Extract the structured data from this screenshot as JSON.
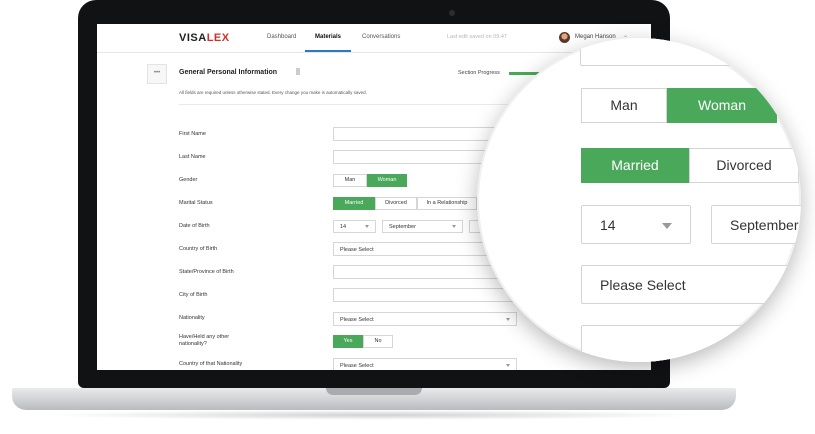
{
  "app": {
    "logo_prefix": "VISA",
    "logo_accent": "LEX"
  },
  "nav": {
    "dashboard": "Dashboard",
    "materials": "Materials",
    "conversations": "Conversations"
  },
  "status": {
    "last_saved": "Last edit saved on 09:47"
  },
  "user": {
    "name": "Megan Hanson"
  },
  "section": {
    "title": "General Personal Information",
    "progress_label": "Section Progress",
    "note": "All fields are required unless otherwise stated. Every change you make is automatically saved."
  },
  "form": {
    "first_name_label": "First Name",
    "last_name_label": "Last Name",
    "gender_label": "Gender",
    "gender_options": [
      "Man",
      "Woman"
    ],
    "marital_label": "Marital Status",
    "marital_options": [
      "Married",
      "Divorced",
      "In a Relationship"
    ],
    "dob_label": "Date of Birth",
    "dob_day": "14",
    "dob_month": "September",
    "country_birth_label": "Country of Birth",
    "country_birth_value": "Please Select",
    "state_birth_label": "State/Province of Birth",
    "city_birth_label": "City of Birth",
    "nationality_label": "Nationality",
    "nationality_value": "Please Select",
    "other_nat_label_1": "Have/Held any other",
    "other_nat_label_2": "nationality?",
    "yes_no": [
      "Yes",
      "No"
    ],
    "country_nat_label": "Country of that Nationality",
    "country_nat_value": "Please Select"
  },
  "colors": {
    "accent_green": "#4aa85b",
    "nav_blue": "#2b78c5",
    "logo_red": "#d0302b"
  }
}
